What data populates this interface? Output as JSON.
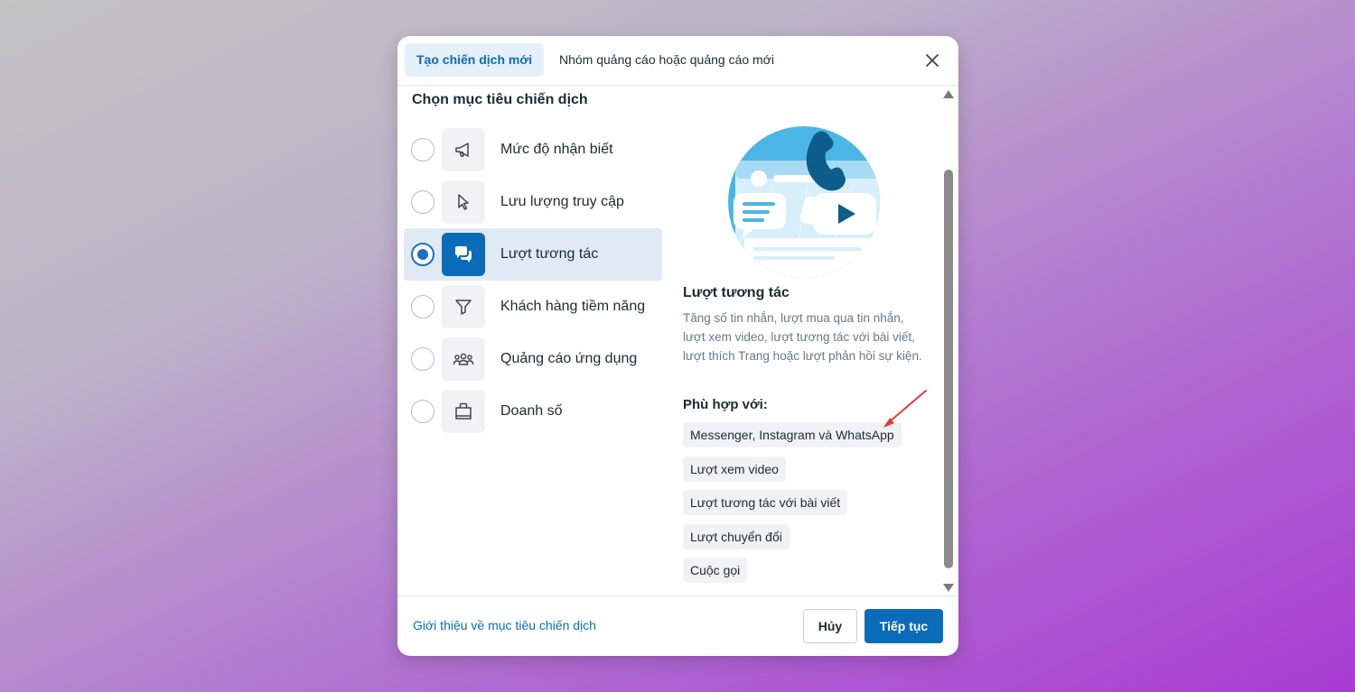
{
  "tabs": [
    {
      "label": "Tạo chiến dịch mới",
      "active": true
    },
    {
      "label": "Nhóm quảng cáo hoặc quảng cáo mới",
      "active": false
    }
  ],
  "section_title": "Chọn mục tiêu chiến dịch",
  "objectives": [
    {
      "label": "Mức độ nhận biết",
      "icon": "megaphone-icon",
      "selected": false
    },
    {
      "label": "Lưu lượng truy cập",
      "icon": "cursor-icon",
      "selected": false
    },
    {
      "label": "Lượt tương tác",
      "icon": "chat-bubbles-icon",
      "selected": true
    },
    {
      "label": "Khách hàng tiềm năng",
      "icon": "funnel-icon",
      "selected": false
    },
    {
      "label": "Quảng cáo ứng dụng",
      "icon": "people-icon",
      "selected": false
    },
    {
      "label": "Doanh số",
      "icon": "shopping-bag-icon",
      "selected": false
    }
  ],
  "detail": {
    "title": "Lượt tương tác",
    "description": "Tăng số tin nhắn, lượt mua qua tin nhắn, lượt xem video, lượt tương tác với bài viết, lượt thích Trang hoặc lượt phản hồi sự kiện.",
    "fit_title": "Phù hợp với:",
    "fits": [
      "Messenger, Instagram và WhatsApp",
      "Lượt xem video",
      "Lượt tương tác với bài viết",
      "Lượt chuyển đổi",
      "Cuộc gọi"
    ]
  },
  "footer": {
    "link": "Giới thiệu về mục tiêu chiến dịch",
    "cancel": "Hủy",
    "continue": "Tiếp tục"
  },
  "colors": {
    "accent": "#0a6bb8",
    "selected_bg": "#dfeaf4",
    "annotation": "#e53935"
  }
}
